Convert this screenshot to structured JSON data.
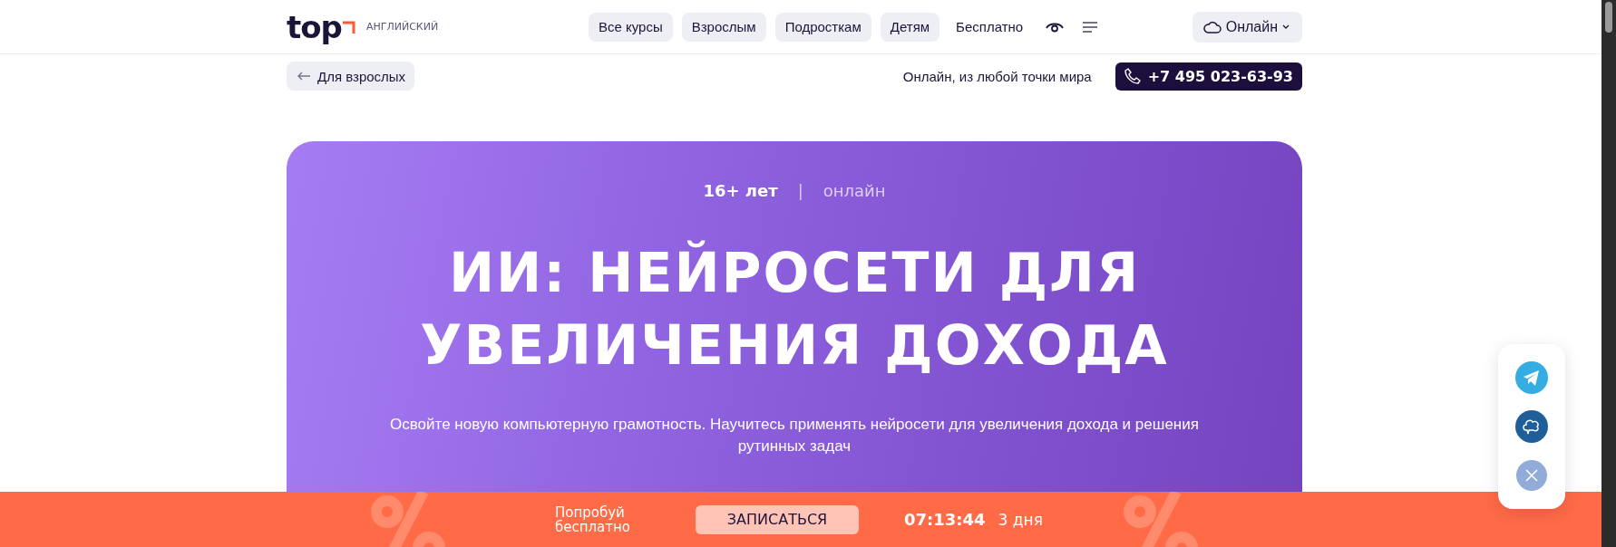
{
  "header": {
    "logo": {
      "wordmark": "top",
      "subtitle": "АНГЛИЙСКИЙ"
    },
    "nav": [
      {
        "label": "Все курсы",
        "kind": "pill"
      },
      {
        "label": "Взрослым",
        "kind": "pill"
      },
      {
        "label": "Подросткам",
        "kind": "pill"
      },
      {
        "label": "Детям",
        "kind": "pill"
      },
      {
        "label": "Бесплатно",
        "kind": "plain"
      }
    ],
    "location_button": {
      "label": "Онлайн"
    }
  },
  "subheader": {
    "back_link": "Для взрослых",
    "note": "Онлайн, из любой точки мира",
    "phone": "+7 495 023-63-93"
  },
  "hero": {
    "age": "16+ лет",
    "separator": "|",
    "format": "онлайн",
    "title": "ИИ: НЕЙРОСЕТИ ДЛЯ УВЕЛИЧЕНИЯ ДОХОДА",
    "description": "Освойте новую компьютерную грамотность. Научитесь применять нейросети для увеличения дохода и решения рутинных задач"
  },
  "promo_bar": {
    "label": "Попробуй бесплатно",
    "button": "ЗАПИСАТЬСЯ",
    "timer": "07:13:44",
    "days": "3 дня"
  }
}
